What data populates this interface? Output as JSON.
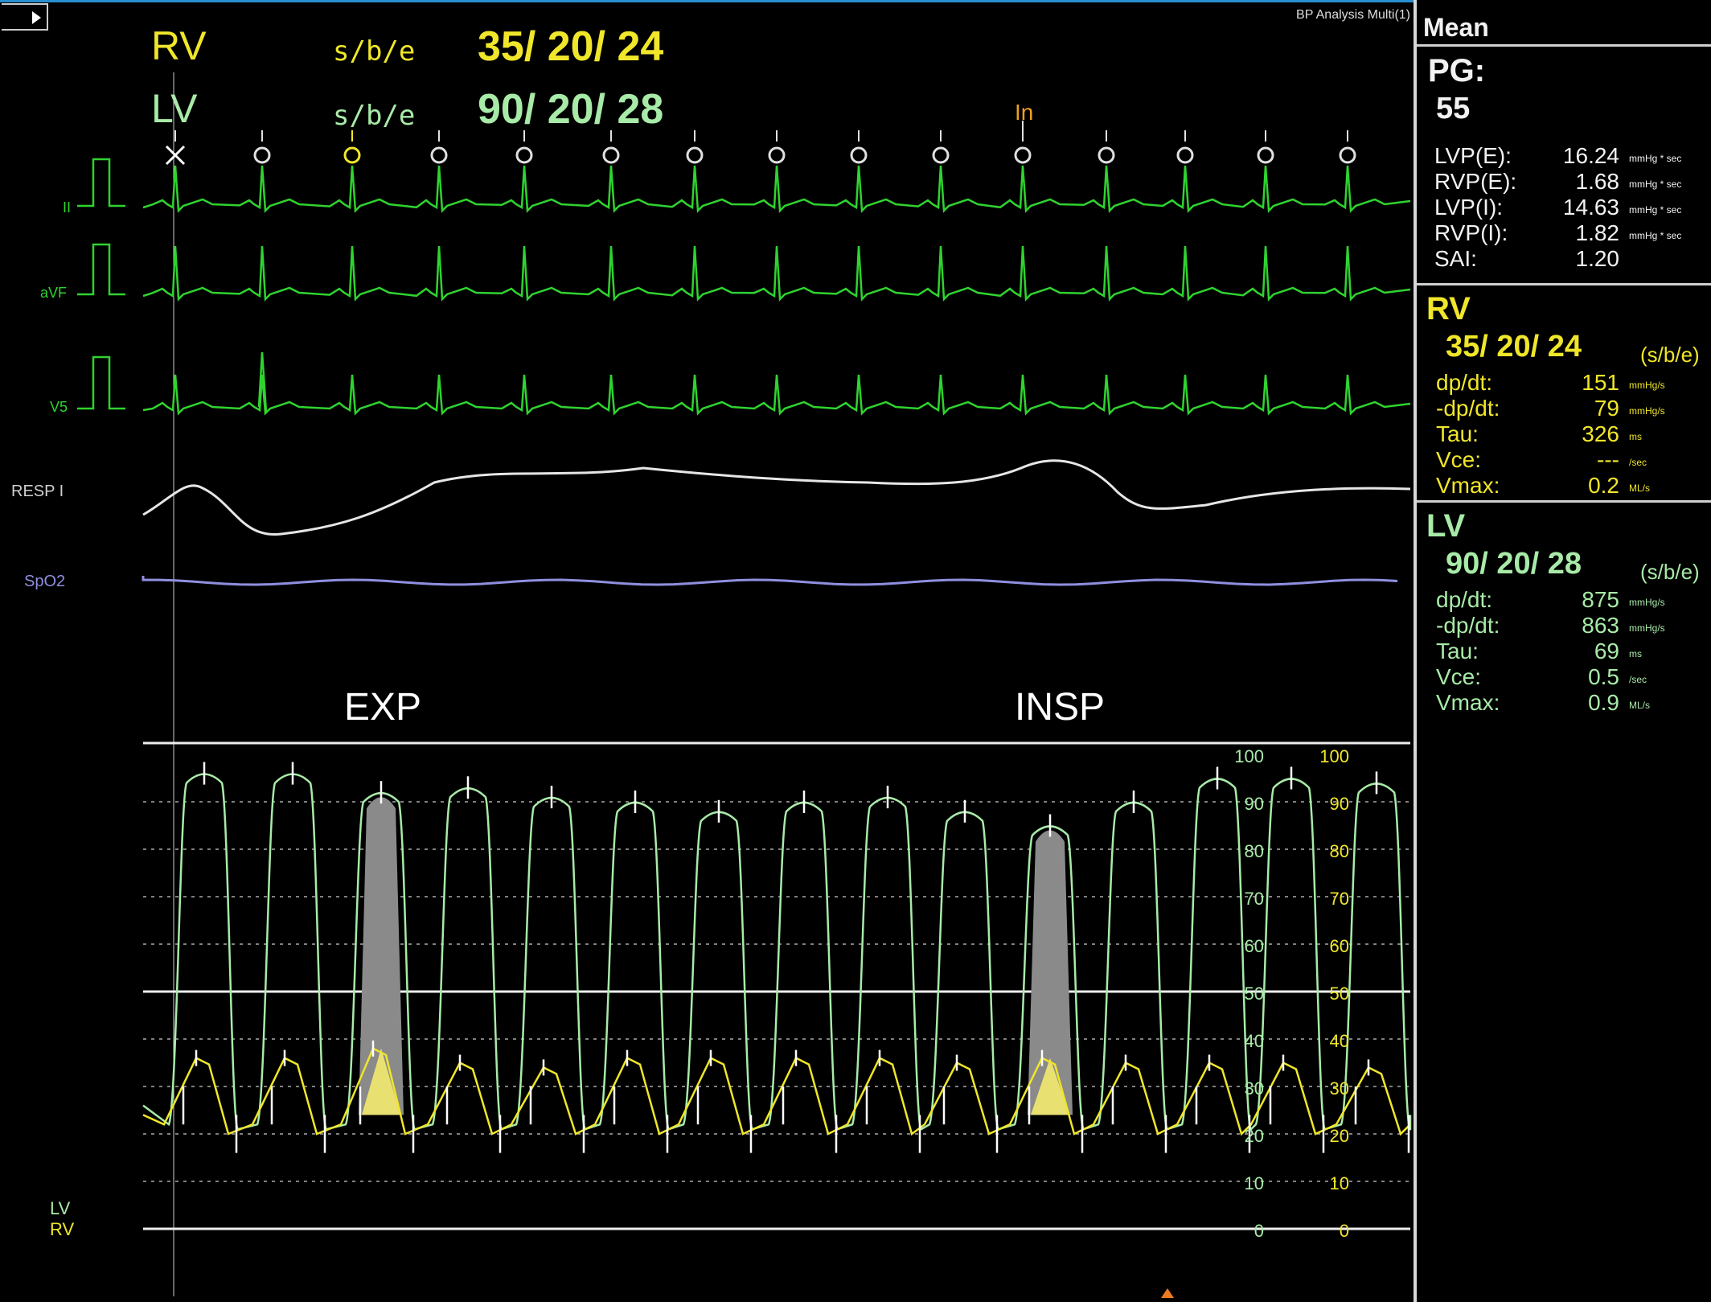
{
  "colors": {
    "ecg": "#2fd32f",
    "resp": "#e6e6e6",
    "spo2": "#8f8fe0",
    "rv": "#f0e62a",
    "lv": "#a8eaa8",
    "background": "#000000",
    "highlight": "#8a8a8a"
  },
  "topbar": {
    "icon": "play-triangle-icon",
    "app_title": "BP Analysis Multi(1)"
  },
  "header": {
    "rv_label": "RV",
    "rv_mode": "s/b/e",
    "rv_values": "35/ 20/ 24",
    "lv_label": "LV",
    "lv_mode": "s/b/e",
    "lv_values": "90/ 20/ 28",
    "marker_in": "In"
  },
  "channels": {
    "ii": "II",
    "avf": "aVF",
    "v5": "V5",
    "resp": "RESP I",
    "spo2": "SpO2"
  },
  "annotations": {
    "exp": "EXP",
    "insp": "INSP"
  },
  "pressure_axis": {
    "ticks_lv": [
      "100",
      "90",
      "80",
      "70",
      "60",
      "50",
      "40",
      "30",
      "20",
      "10",
      "0"
    ],
    "ticks_rv": [
      "100",
      "90",
      "80",
      "70",
      "60",
      "50",
      "40",
      "30",
      "20",
      "10",
      "0"
    ],
    "legend_lv": "LV",
    "legend_rv": "RV"
  },
  "panel": {
    "mean_title": "Mean",
    "pg_label": "PG:",
    "pg_value": "55",
    "pg_rows": [
      {
        "label": "LVP(E):",
        "value": "16.24",
        "unit": "mmHg * sec"
      },
      {
        "label": "RVP(E):",
        "value": "1.68",
        "unit": "mmHg * sec"
      },
      {
        "label": "LVP(I):",
        "value": "14.63",
        "unit": "mmHg * sec"
      },
      {
        "label": "RVP(I):",
        "value": "1.82",
        "unit": "mmHg * sec"
      },
      {
        "label": "SAI:",
        "value": "1.20",
        "unit": ""
      }
    ],
    "rv": {
      "title": "RV",
      "values": "35/ 20/ 24",
      "mode": "(s/b/e)",
      "rows": [
        {
          "label": "dp/dt:",
          "value": "151",
          "unit": "mmHg/s"
        },
        {
          "label": "-dp/dt:",
          "value": "79",
          "unit": "mmHg/s"
        },
        {
          "label": "Tau:",
          "value": "326",
          "unit": "ms"
        },
        {
          "label": "Vce:",
          "value": "---",
          "unit": "/sec"
        },
        {
          "label": "Vmax:",
          "value": "0.2",
          "unit": "ML/s"
        }
      ]
    },
    "lv": {
      "title": "LV",
      "values": "90/ 20/ 28",
      "mode": "(s/b/e)",
      "rows": [
        {
          "label": "dp/dt:",
          "value": "875",
          "unit": "mmHg/s"
        },
        {
          "label": "-dp/dt:",
          "value": "863",
          "unit": "mmHg/s"
        },
        {
          "label": "Tau:",
          "value": "69",
          "unit": "ms"
        },
        {
          "label": "Vce:",
          "value": "0.5",
          "unit": "/sec"
        },
        {
          "label": "Vmax:",
          "value": "0.9",
          "unit": "ML/s"
        }
      ]
    }
  }
}
